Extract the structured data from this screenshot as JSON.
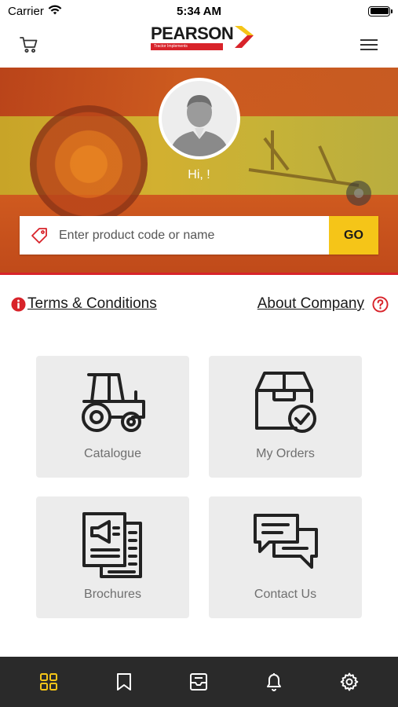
{
  "status_bar": {
    "carrier": "Carrier",
    "time": "5:34 AM",
    "battery_level": 1.0
  },
  "header": {
    "logo_text": "PEARSON",
    "logo_subtext": "Tractor Implements",
    "cart_icon": "cart-icon",
    "menu_icon": "hamburger-menu-icon"
  },
  "hero": {
    "greeting": "Hi, !",
    "avatar_icon": "user-avatar-icon"
  },
  "search": {
    "placeholder": "Enter product code or name",
    "value": "",
    "go_label": "GO",
    "tag_icon": "price-tag-icon"
  },
  "links": {
    "terms_label": "Terms & Conditions",
    "terms_icon": "info-icon",
    "about_label": "About Company",
    "about_icon": "help-icon"
  },
  "tiles": [
    {
      "label": "Catalogue",
      "icon": "tractor-icon"
    },
    {
      "label": "My Orders",
      "icon": "order-box-check-icon"
    },
    {
      "label": "Brochures",
      "icon": "brochure-megaphone-icon"
    },
    {
      "label": "Contact Us",
      "icon": "chat-bubbles-icon"
    }
  ],
  "tab_bar": {
    "items": [
      {
        "icon": "grid-icon",
        "active": true
      },
      {
        "icon": "bookmark-icon",
        "active": false
      },
      {
        "icon": "inbox-icon",
        "active": false
      },
      {
        "icon": "bell-icon",
        "active": false
      },
      {
        "icon": "settings-gear-icon",
        "active": false
      }
    ]
  },
  "colors": {
    "accent_yellow": "#F5C518",
    "brand_red": "#D8232A",
    "tab_bar_bg": "#2A2A2A",
    "tile_bg": "#ECECEC"
  }
}
